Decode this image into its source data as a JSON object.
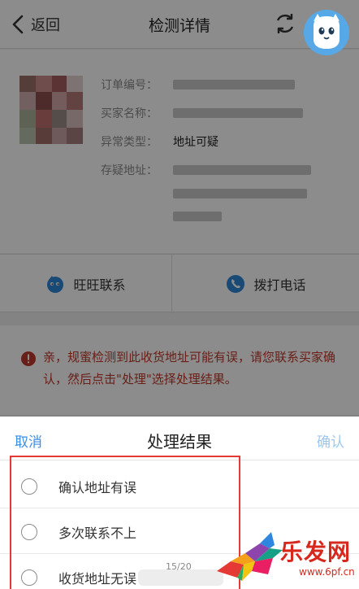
{
  "navbar": {
    "back_label": "返回",
    "title": "检测详情"
  },
  "order": {
    "fields": [
      {
        "label": "订单编号：",
        "value": ""
      },
      {
        "label": "买家名称：",
        "value": ""
      },
      {
        "label": "异常类型：",
        "value": "地址可疑"
      },
      {
        "label": "存疑地址：",
        "value": ""
      }
    ]
  },
  "contact": {
    "wangwang_label": "旺旺联系",
    "phone_label": "拨打电话"
  },
  "warning": {
    "text": "亲，规蜜检测到此收货地址可能有误，请您联系买家确认，然后点击\"处理\"选择处理结果。"
  },
  "sheet": {
    "cancel_label": "取消",
    "title": "处理结果",
    "confirm_label": "确认",
    "options": [
      {
        "label": "确认地址有误"
      },
      {
        "label": "多次联系不上"
      },
      {
        "label": "收货地址无误"
      }
    ],
    "page_counter": "15/20"
  },
  "watermark": {
    "text": "乐发网",
    "url": "www.6pf.cn"
  },
  "colors": {
    "accent_blue": "#3a8ee6",
    "confirm_disabled": "#9cc7f0",
    "warning_red": "#c0392b",
    "highlight_border": "#e53935"
  }
}
